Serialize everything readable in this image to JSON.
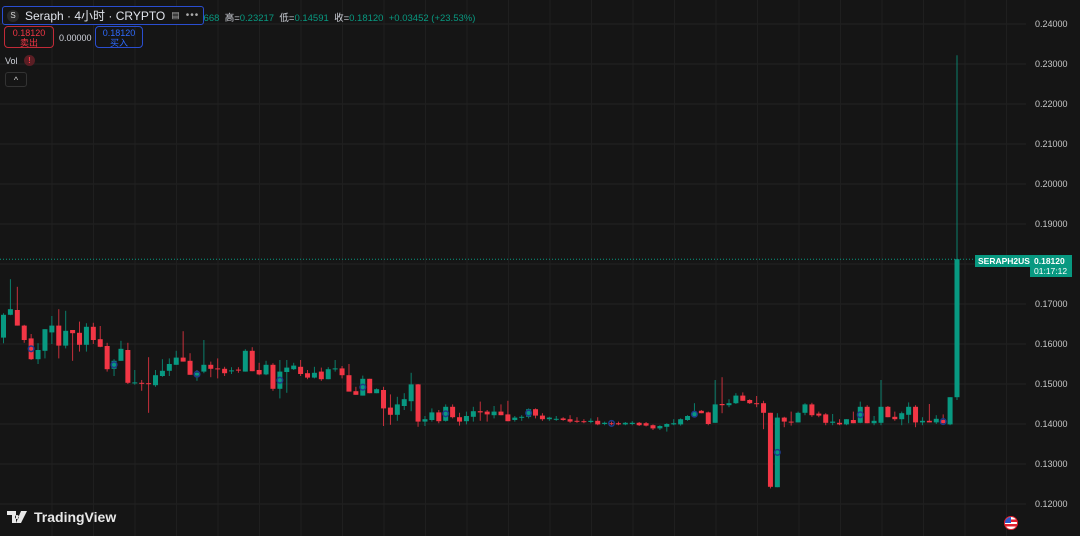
{
  "header": {
    "symbol_logo": "S",
    "title": "Seraph · 4小时 · CRYPTO",
    "more_icon": "more-dots-icon",
    "flag_icon": "flag-icon",
    "ohlc": {
      "open_label": "开=",
      "open": "0.14668",
      "high_label": "高=",
      "high": "0.23217",
      "low_label": "低=",
      "low": "0.14591",
      "close_label": "收=",
      "close": "0.18120",
      "change": "+0.03452 (+23.53%)"
    }
  },
  "trade": {
    "sell_price": "0.18120",
    "sell_label": "卖出",
    "spread": "0.00000",
    "buy_price": "0.18120",
    "buy_label": "买入"
  },
  "indicator": {
    "vol_label": "Vol",
    "warning_icon": "!",
    "collapse_icon": "^"
  },
  "price_tag": {
    "symbol": "SERAPH2USD",
    "price": "0.18120",
    "countdown": "01:17:12"
  },
  "branding": {
    "logo_text": "TradingView"
  },
  "colors": {
    "up": "#089981",
    "down": "#f23645",
    "background": "#151515",
    "grid": "#242424",
    "marker": "#1e3a8a"
  },
  "chart_data": {
    "type": "candlestick",
    "ylim": [
      0.12,
      0.24
    ],
    "y_ticks": [
      "0.24000",
      "0.23000",
      "0.22000",
      "0.21000",
      "0.20000",
      "0.19000",
      "0.18000",
      "0.17000",
      "0.16000",
      "0.15000",
      "0.14000",
      "0.13000",
      "0.12000"
    ],
    "grid": true,
    "last_price": 0.1812,
    "event_markers": [
      5,
      17,
      29,
      41,
      53,
      65,
      77,
      89,
      101,
      113,
      125,
      137
    ],
    "ohlc": [
      [
        0.1616,
        0.1677,
        0.1602,
        0.1673
      ],
      [
        0.1673,
        0.1762,
        0.1672,
        0.1687
      ],
      [
        0.1685,
        0.1743,
        0.1646,
        0.1646
      ],
      [
        0.1646,
        0.1648,
        0.1603,
        0.161
      ],
      [
        0.1614,
        0.1625,
        0.156,
        0.1562
      ],
      [
        0.1562,
        0.1602,
        0.155,
        0.1585
      ],
      [
        0.1583,
        0.1637,
        0.1564,
        0.1637
      ],
      [
        0.1629,
        0.167,
        0.16,
        0.1646
      ],
      [
        0.1646,
        0.1687,
        0.1564,
        0.1596
      ],
      [
        0.1596,
        0.1683,
        0.1589,
        0.1633
      ],
      [
        0.1635,
        0.1635,
        0.1558,
        0.1627
      ],
      [
        0.1628,
        0.1656,
        0.1581,
        0.1598
      ],
      [
        0.1598,
        0.1652,
        0.1581,
        0.1643
      ],
      [
        0.1643,
        0.1653,
        0.16,
        0.161
      ],
      [
        0.1612,
        0.1645,
        0.1592,
        0.1593
      ],
      [
        0.1595,
        0.1603,
        0.1531,
        0.1537
      ],
      [
        0.1538,
        0.1562,
        0.152,
        0.1558
      ],
      [
        0.1558,
        0.1608,
        0.1558,
        0.1588
      ],
      [
        0.1585,
        0.1603,
        0.15,
        0.1503
      ],
      [
        0.1503,
        0.1535,
        0.1498,
        0.1504
      ],
      [
        0.1503,
        0.151,
        0.1483,
        0.1501
      ],
      [
        0.1502,
        0.1567,
        0.1428,
        0.1501
      ],
      [
        0.1497,
        0.1535,
        0.1493,
        0.1522
      ],
      [
        0.152,
        0.1562,
        0.1518,
        0.1533
      ],
      [
        0.1533,
        0.1564,
        0.152,
        0.155
      ],
      [
        0.1548,
        0.1583,
        0.1548,
        0.1566
      ],
      [
        0.1566,
        0.1632,
        0.1556,
        0.1556
      ],
      [
        0.1558,
        0.1577,
        0.1523,
        0.1523
      ],
      [
        0.1521,
        0.1535,
        0.1508,
        0.1528
      ],
      [
        0.1531,
        0.161,
        0.1527,
        0.1548
      ],
      [
        0.1548,
        0.1556,
        0.1517,
        0.1538
      ],
      [
        0.1539,
        0.1564,
        0.1514,
        0.1537
      ],
      [
        0.1538,
        0.1543,
        0.152,
        0.1527
      ],
      [
        0.1533,
        0.1542,
        0.1525,
        0.1534
      ],
      [
        0.1536,
        0.1542,
        0.1528,
        0.1535
      ],
      [
        0.1531,
        0.1587,
        0.1531,
        0.1583
      ],
      [
        0.1583,
        0.1592,
        0.1532,
        0.1532
      ],
      [
        0.1535,
        0.1553,
        0.1522,
        0.1524
      ],
      [
        0.1524,
        0.1558,
        0.1522,
        0.1548
      ],
      [
        0.1548,
        0.1552,
        0.1483,
        0.1488
      ],
      [
        0.1488,
        0.156,
        0.1464,
        0.1531
      ],
      [
        0.153,
        0.156,
        0.1478,
        0.1541
      ],
      [
        0.1537,
        0.1553,
        0.1535,
        0.1546
      ],
      [
        0.1543,
        0.156,
        0.152,
        0.1525
      ],
      [
        0.1527,
        0.1535,
        0.1512,
        0.1516
      ],
      [
        0.1516,
        0.1543,
        0.1514,
        0.1528
      ],
      [
        0.1531,
        0.1541,
        0.1508,
        0.1512
      ],
      [
        0.1512,
        0.1542,
        0.1512,
        0.1537
      ],
      [
        0.1538,
        0.156,
        0.1531,
        0.1539
      ],
      [
        0.1539,
        0.1545,
        0.1514,
        0.1522
      ],
      [
        0.1522,
        0.155,
        0.1481,
        0.1481
      ],
      [
        0.1482,
        0.1493,
        0.1473,
        0.1473
      ],
      [
        0.1471,
        0.1521,
        0.1471,
        0.1513
      ],
      [
        0.1513,
        0.1513,
        0.1477,
        0.1477
      ],
      [
        0.1477,
        0.1489,
        0.1477,
        0.1487
      ],
      [
        0.1485,
        0.1493,
        0.1395,
        0.1439
      ],
      [
        0.1441,
        0.1474,
        0.1398,
        0.1423
      ],
      [
        0.1423,
        0.1468,
        0.1408,
        0.1449
      ],
      [
        0.1445,
        0.1477,
        0.1435,
        0.1462
      ],
      [
        0.1457,
        0.1528,
        0.1432,
        0.1499
      ],
      [
        0.1499,
        0.15,
        0.1393,
        0.1406
      ],
      [
        0.1406,
        0.142,
        0.1395,
        0.1412
      ],
      [
        0.141,
        0.1439,
        0.1406,
        0.1429
      ],
      [
        0.1429,
        0.1435,
        0.1402,
        0.1407
      ],
      [
        0.1408,
        0.1449,
        0.1406,
        0.1443
      ],
      [
        0.1443,
        0.1449,
        0.1414,
        0.1417
      ],
      [
        0.1417,
        0.1428,
        0.1396,
        0.1406
      ],
      [
        0.1407,
        0.1431,
        0.1399,
        0.142
      ],
      [
        0.1418,
        0.1443,
        0.1406,
        0.1432
      ],
      [
        0.1432,
        0.1456,
        0.1408,
        0.1429
      ],
      [
        0.1431,
        0.1435,
        0.1406,
        0.1424
      ],
      [
        0.1422,
        0.1445,
        0.1414,
        0.1431
      ],
      [
        0.1431,
        0.1449,
        0.1422,
        0.1422
      ],
      [
        0.1424,
        0.1458,
        0.1407,
        0.1407
      ],
      [
        0.141,
        0.142,
        0.1406,
        0.1416
      ],
      [
        0.1416,
        0.1422,
        0.1408,
        0.1418
      ],
      [
        0.1418,
        0.1439,
        0.1414,
        0.1437
      ],
      [
        0.1437,
        0.1439,
        0.1414,
        0.1421
      ],
      [
        0.1421,
        0.1427,
        0.1408,
        0.1412
      ],
      [
        0.1412,
        0.1418,
        0.1408,
        0.1416
      ],
      [
        0.1412,
        0.142,
        0.1408,
        0.1413
      ],
      [
        0.1414,
        0.1417,
        0.1408,
        0.141
      ],
      [
        0.1412,
        0.1422,
        0.1403,
        0.1406
      ],
      [
        0.1408,
        0.1417,
        0.1403,
        0.1406
      ],
      [
        0.1407,
        0.1412,
        0.1402,
        0.1405
      ],
      [
        0.1405,
        0.1414,
        0.1402,
        0.1408
      ],
      [
        0.1408,
        0.1417,
        0.1397,
        0.1399
      ],
      [
        0.14,
        0.1406,
        0.1397,
        0.1403
      ],
      [
        0.1402,
        0.1406,
        0.1397,
        0.1401
      ],
      [
        0.1402,
        0.1406,
        0.1397,
        0.1399
      ],
      [
        0.1399,
        0.1405,
        0.1397,
        0.1403
      ],
      [
        0.14,
        0.1407,
        0.1397,
        0.1403
      ],
      [
        0.1403,
        0.1405,
        0.1395,
        0.1397
      ],
      [
        0.1402,
        0.1405,
        0.1394,
        0.1396
      ],
      [
        0.1397,
        0.1399,
        0.1385,
        0.1389
      ],
      [
        0.1389,
        0.1397,
        0.1385,
        0.1395
      ],
      [
        0.1393,
        0.1402,
        0.1381,
        0.14
      ],
      [
        0.1399,
        0.1412,
        0.1397,
        0.1402
      ],
      [
        0.1399,
        0.1414,
        0.1396,
        0.1412
      ],
      [
        0.141,
        0.1422,
        0.1408,
        0.142
      ],
      [
        0.1418,
        0.1452,
        0.1418,
        0.1431
      ],
      [
        0.1433,
        0.1435,
        0.1427,
        0.1427
      ],
      [
        0.1429,
        0.1431,
        0.1397,
        0.14
      ],
      [
        0.1403,
        0.151,
        0.1403,
        0.1449
      ],
      [
        0.145,
        0.1517,
        0.1427,
        0.1447
      ],
      [
        0.1447,
        0.1462,
        0.1442,
        0.1452
      ],
      [
        0.1452,
        0.1477,
        0.145,
        0.1471
      ],
      [
        0.1471,
        0.1479,
        0.1458,
        0.1458
      ],
      [
        0.146,
        0.1462,
        0.145,
        0.1452
      ],
      [
        0.1452,
        0.147,
        0.1442,
        0.145
      ],
      [
        0.1452,
        0.1458,
        0.1387,
        0.1428
      ],
      [
        0.1428,
        0.1428,
        0.1239,
        0.1243
      ],
      [
        0.1242,
        0.1427,
        0.1242,
        0.1416
      ],
      [
        0.1416,
        0.1418,
        0.1392,
        0.1406
      ],
      [
        0.1406,
        0.1431,
        0.1396,
        0.1404
      ],
      [
        0.1404,
        0.1431,
        0.1404,
        0.1428
      ],
      [
        0.1428,
        0.1452,
        0.1422,
        0.1449
      ],
      [
        0.1449,
        0.1453,
        0.1418,
        0.1422
      ],
      [
        0.1426,
        0.1431,
        0.1417,
        0.1421
      ],
      [
        0.1424,
        0.1427,
        0.1397,
        0.1403
      ],
      [
        0.1403,
        0.1425,
        0.1397,
        0.1406
      ],
      [
        0.1403,
        0.1412,
        0.1397,
        0.1399
      ],
      [
        0.1399,
        0.1412,
        0.1397,
        0.1412
      ],
      [
        0.141,
        0.1431,
        0.1402,
        0.1402
      ],
      [
        0.1403,
        0.1456,
        0.1402,
        0.1443
      ],
      [
        0.1443,
        0.1447,
        0.1402,
        0.1402
      ],
      [
        0.1402,
        0.142,
        0.1397,
        0.1408
      ],
      [
        0.1403,
        0.151,
        0.1397,
        0.1443
      ],
      [
        0.1443,
        0.1445,
        0.1417,
        0.1417
      ],
      [
        0.1418,
        0.1431,
        0.1408,
        0.1412
      ],
      [
        0.1412,
        0.1431,
        0.1397,
        0.1427
      ],
      [
        0.1423,
        0.1454,
        0.1402,
        0.1443
      ],
      [
        0.1443,
        0.1447,
        0.1392,
        0.1404
      ],
      [
        0.1404,
        0.1417,
        0.1397,
        0.1408
      ],
      [
        0.1408,
        0.145,
        0.1404,
        0.1404
      ],
      [
        0.1404,
        0.1422,
        0.14,
        0.1413
      ],
      [
        0.141,
        0.1424,
        0.1402,
        0.1402
      ],
      [
        0.1399,
        0.1467,
        0.1397,
        0.1467
      ],
      [
        0.1467,
        0.2322,
        0.146,
        0.1812
      ]
    ]
  }
}
